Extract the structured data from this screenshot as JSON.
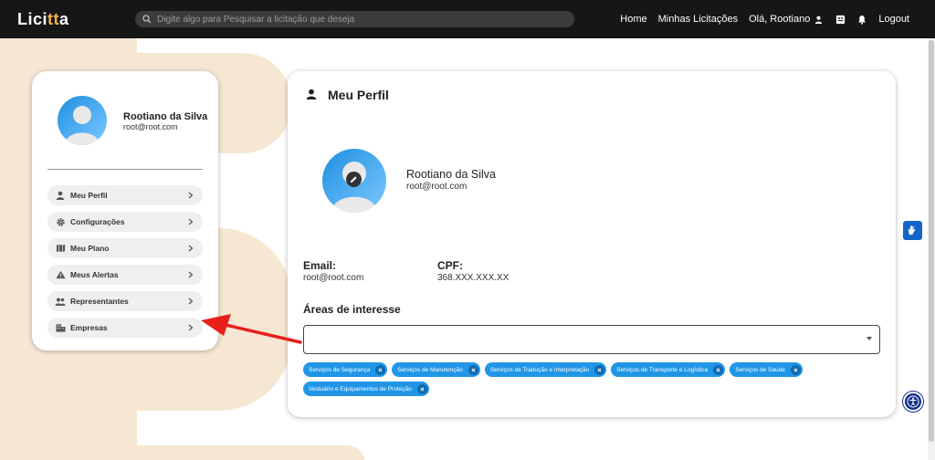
{
  "header": {
    "logo_prefix": "Lici",
    "logo_accent": "tt",
    "logo_suffix": "a",
    "search_placeholder": "Digite algo para Pesquisar a licitação que deseja",
    "nav": {
      "home": "Home",
      "minhas_licitacoes": "Minhas Licitações",
      "greeting": "Olá, Rootiano",
      "logout": "Logout"
    }
  },
  "sidebar": {
    "user_name": "Rootiano da Silva",
    "user_email": "root@root.com",
    "items": [
      {
        "label": "Meu Perfil",
        "icon": "person-icon"
      },
      {
        "label": "Configurações",
        "icon": "gear-icon"
      },
      {
        "label": "Meu Plano",
        "icon": "map-icon"
      },
      {
        "label": "Meus Alertas",
        "icon": "warning-icon"
      },
      {
        "label": "Representantes",
        "icon": "group-icon"
      },
      {
        "label": "Empresas",
        "icon": "building-icon"
      }
    ]
  },
  "profile": {
    "title": "Meu Perfil",
    "name": "Rootiano da Silva",
    "email": "root@root.com",
    "email_label": "Email:",
    "email_value": "root@root.com",
    "cpf_label": "CPF:",
    "cpf_value": "368.XXX.XXX.XX",
    "areas_title": "Áreas de interesse",
    "areas": [
      "Serviços de Segurança",
      "Serviços de Manutenção",
      "Serviços de Tradução e Interpretação",
      "Serviços de Transporte e Logística",
      "Serviços de Saúde",
      "Vestuário e Equipamentos de Proteção"
    ]
  },
  "colors": {
    "topbar": "#161616",
    "accent_logo": "#f0b34d",
    "chip": "#2196e6",
    "arrow": "#e8201c",
    "background_shape": "#f6e7d3"
  }
}
